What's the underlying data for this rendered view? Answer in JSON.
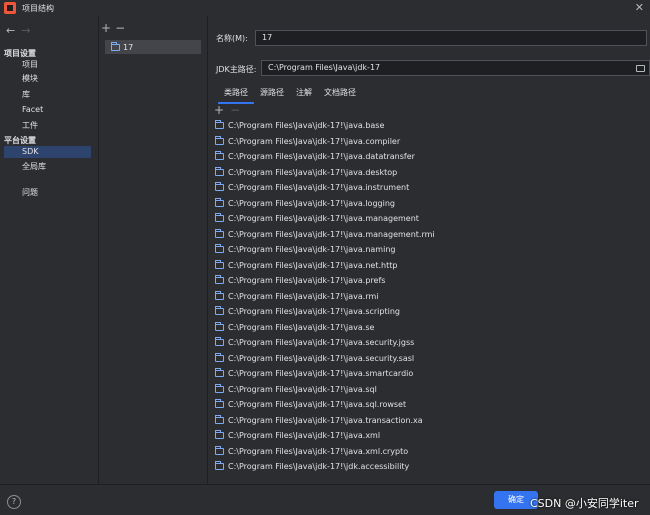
{
  "window": {
    "title": "项目结构"
  },
  "nav": {
    "section_project": "项目设置",
    "project_items": [
      "项目",
      "模块",
      "库",
      "Facet",
      "工件"
    ],
    "section_platform": "平台设置",
    "platform_items": [
      "SDK",
      "全局库"
    ],
    "problems": "问题",
    "selected": "SDK"
  },
  "sdk_list": {
    "items": [
      "17"
    ]
  },
  "form": {
    "name_label": "名称(M):",
    "name_value": "17",
    "home_label": "JDK主路径:",
    "home_value": "C:\\Program Files\\Java\\jdk-17"
  },
  "tabs": [
    "类路径",
    "源路径",
    "注解",
    "文档路径"
  ],
  "active_tab": "类路径",
  "classpath": [
    "C:\\Program Files\\Java\\jdk-17!\\java.base",
    "C:\\Program Files\\Java\\jdk-17!\\java.compiler",
    "C:\\Program Files\\Java\\jdk-17!\\java.datatransfer",
    "C:\\Program Files\\Java\\jdk-17!\\java.desktop",
    "C:\\Program Files\\Java\\jdk-17!\\java.instrument",
    "C:\\Program Files\\Java\\jdk-17!\\java.logging",
    "C:\\Program Files\\Java\\jdk-17!\\java.management",
    "C:\\Program Files\\Java\\jdk-17!\\java.management.rmi",
    "C:\\Program Files\\Java\\jdk-17!\\java.naming",
    "C:\\Program Files\\Java\\jdk-17!\\java.net.http",
    "C:\\Program Files\\Java\\jdk-17!\\java.prefs",
    "C:\\Program Files\\Java\\jdk-17!\\java.rmi",
    "C:\\Program Files\\Java\\jdk-17!\\java.scripting",
    "C:\\Program Files\\Java\\jdk-17!\\java.se",
    "C:\\Program Files\\Java\\jdk-17!\\java.security.jgss",
    "C:\\Program Files\\Java\\jdk-17!\\java.security.sasl",
    "C:\\Program Files\\Java\\jdk-17!\\java.smartcardio",
    "C:\\Program Files\\Java\\jdk-17!\\java.sql",
    "C:\\Program Files\\Java\\jdk-17!\\java.sql.rowset",
    "C:\\Program Files\\Java\\jdk-17!\\java.transaction.xa",
    "C:\\Program Files\\Java\\jdk-17!\\java.xml",
    "C:\\Program Files\\Java\\jdk-17!\\java.xml.crypto",
    "C:\\Program Files\\Java\\jdk-17!\\jdk.accessibility"
  ],
  "footer": {
    "ok_label": "确定",
    "watermark": "CSDN @小安同学iter"
  },
  "colors": {
    "accent": "#3574f0",
    "background": "#2b2d30",
    "selection": "#2e436e"
  }
}
